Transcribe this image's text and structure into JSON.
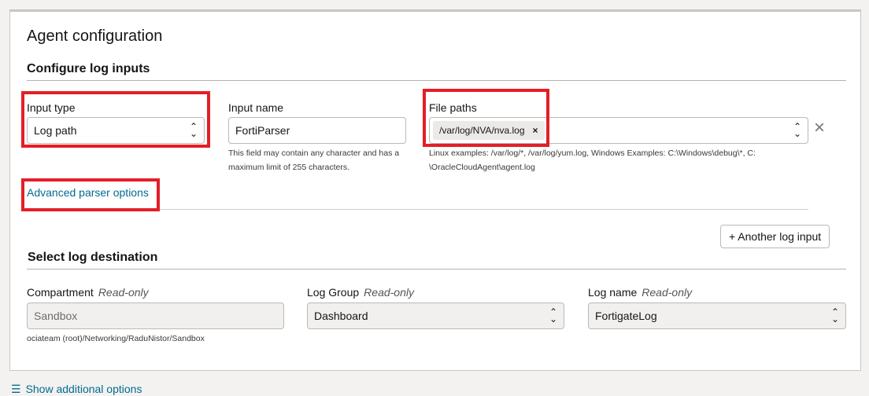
{
  "title": "Agent configuration",
  "log_inputs": {
    "heading": "Configure log inputs",
    "input_type": {
      "label": "Input type",
      "value": "Log path"
    },
    "input_name": {
      "label": "Input name",
      "value": "FortiParser",
      "help": "This field may contain any character and has a maximum limit of 255 characters."
    },
    "file_paths": {
      "label": "File paths",
      "chips": [
        "/var/log/NVA/nva.log"
      ],
      "help": "Linux examples: /var/log/*, /var/log/yum.log,  Windows Examples: C:\\Windows\\debug\\*, C: \\OracleCloudAgent\\agent.log"
    },
    "advanced_link": "Advanced parser options",
    "another_button": "+ Another log input"
  },
  "destination": {
    "heading": "Select log destination",
    "compartment": {
      "label": "Compartment",
      "tag": "Read-only",
      "value": "Sandbox",
      "help": "ociateam (root)/Networking/RaduNistor/Sandbox"
    },
    "log_group": {
      "label": "Log Group",
      "tag": "Read-only",
      "value": "Dashboard"
    },
    "log_name": {
      "label": "Log name",
      "tag": "Read-only",
      "value": "FortigateLog"
    }
  },
  "footer_link": "Show additional options",
  "colors": {
    "highlight": "#e41e26",
    "link": "#006b8f"
  }
}
